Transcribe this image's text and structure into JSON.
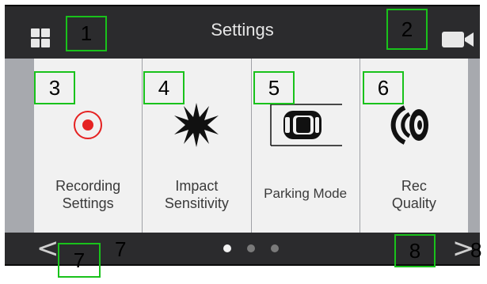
{
  "header": {
    "title": "Settings",
    "left_icon": "grid-menu-icon",
    "right_icon": "video-camera-icon"
  },
  "tiles": [
    {
      "label": "Recording\nSettings",
      "icon": "record-icon"
    },
    {
      "label": "Impact\nSensitivity",
      "icon": "impact-burst-icon"
    },
    {
      "label": "Parking Mode",
      "icon": "parking-car-icon"
    },
    {
      "label": "Rec\nQuality",
      "icon": "rec-quality-speaker-icon"
    }
  ],
  "footer": {
    "prev_symbol": "<",
    "next_symbol": ">",
    "page_indicator": {
      "pages": 3,
      "active_page": 1
    }
  },
  "annotations": [
    "1",
    "2",
    "3",
    "4",
    "5",
    "6",
    "7",
    "8",
    "7",
    "8"
  ],
  "colors": {
    "bar_background": "#2b2b2d",
    "tile_background": "#f1f1f1",
    "content_background": "#a7a9ae",
    "record_red": "#e52222",
    "annotation_green": "#19c21b"
  }
}
